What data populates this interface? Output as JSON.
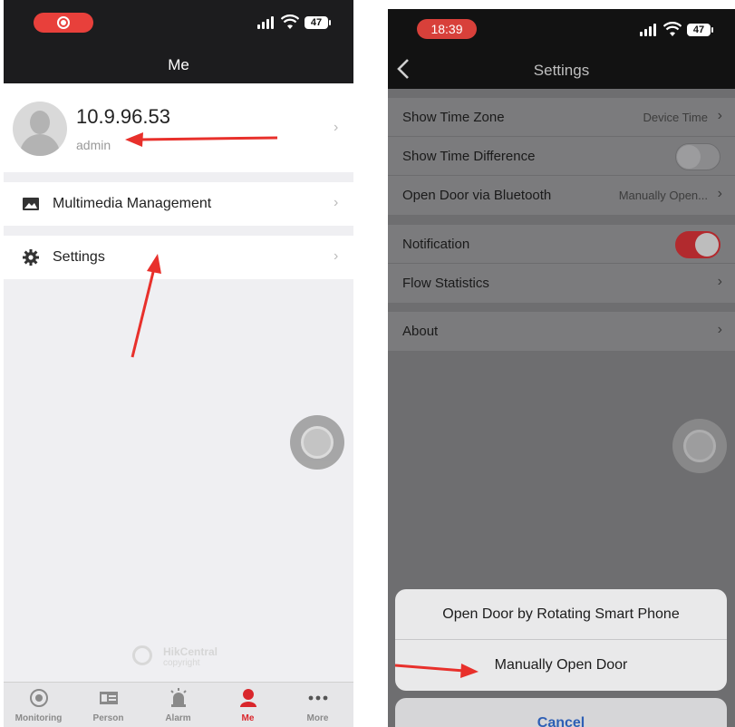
{
  "left_screen": {
    "title": "Me",
    "profile": {
      "server": "10.9.96.53",
      "username": "admin"
    },
    "menu": [
      {
        "label": "Multimedia Management",
        "icon": "image-icon"
      },
      {
        "label": "Settings",
        "icon": "gear-icon"
      }
    ],
    "watermark": {
      "brand": "HikCentral",
      "sub": "copyright"
    },
    "tabs": [
      {
        "label": "Monitoring",
        "icon": "camera-icon",
        "active": false
      },
      {
        "label": "Person",
        "icon": "id-card-icon",
        "active": false
      },
      {
        "label": "Alarm",
        "icon": "siren-icon",
        "active": false
      },
      {
        "label": "Me",
        "icon": "user-icon",
        "active": true
      },
      {
        "label": "More",
        "icon": "more-icon",
        "active": false
      }
    ],
    "battery": "47"
  },
  "right_screen": {
    "status_time": "18:39",
    "battery": "47",
    "title": "Settings",
    "group1": [
      {
        "label": "Show Time Zone",
        "value": "Device Time"
      },
      {
        "label": "Show Time Difference",
        "toggle": false
      },
      {
        "label": "Open Door via Bluetooth",
        "value": "Manually Open..."
      }
    ],
    "group2": [
      {
        "label": "Notification",
        "toggle": true
      },
      {
        "label": "Flow Statistics"
      }
    ],
    "group3": [
      {
        "label": "About"
      }
    ],
    "action_sheet": {
      "options": [
        "Open Door by Rotating Smart Phone",
        "Manually Open Door"
      ],
      "cancel": "Cancel"
    }
  },
  "colors": {
    "accent_red": "#e8403b",
    "toggle_on": "#b22a2e",
    "cancel_blue": "#2e5fb5"
  }
}
